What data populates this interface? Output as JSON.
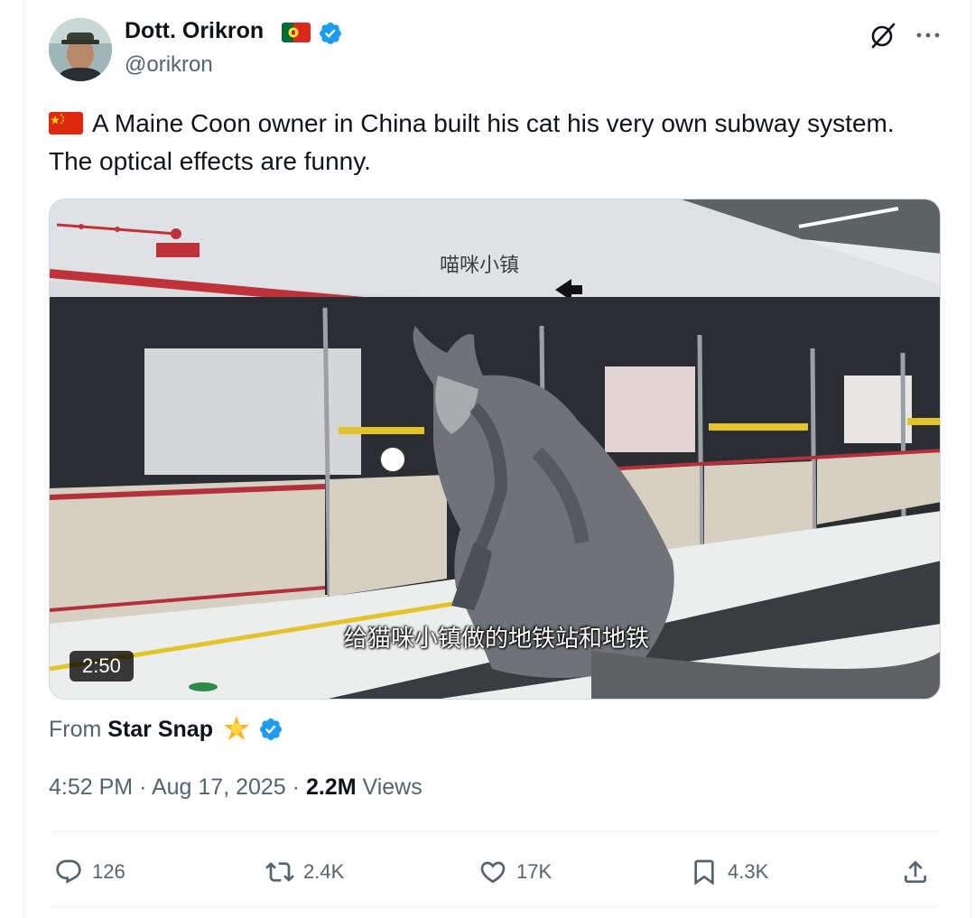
{
  "author": {
    "display_name": "Dott. Orikron",
    "handle": "@orikron",
    "flag": "portugal-flag-icon",
    "verified": true
  },
  "tweet": {
    "flag": "china-flag-icon",
    "text": "A Maine Coon owner in China built his cat his very own subway system. The optical effects are funny."
  },
  "media": {
    "duration": "2:50",
    "subtitle": "给猫咪小镇做的地铁站和地铁"
  },
  "source": {
    "prefix": "From",
    "app_name": "Star Snap",
    "emoji": "star-emoji-icon"
  },
  "meta": {
    "time": "4:52 PM",
    "separator1": "·",
    "date": "Aug 17, 2025",
    "separator2": "·",
    "views_count": "2.2M",
    "views_label": "Views"
  },
  "actions": {
    "replies": "126",
    "reposts": "2.4K",
    "likes": "17K",
    "bookmarks": "4.3K"
  },
  "colors": {
    "verified": "#1d9bf0",
    "text_primary": "#0f1419",
    "text_secondary": "#536471",
    "border": "#eff3f4"
  }
}
